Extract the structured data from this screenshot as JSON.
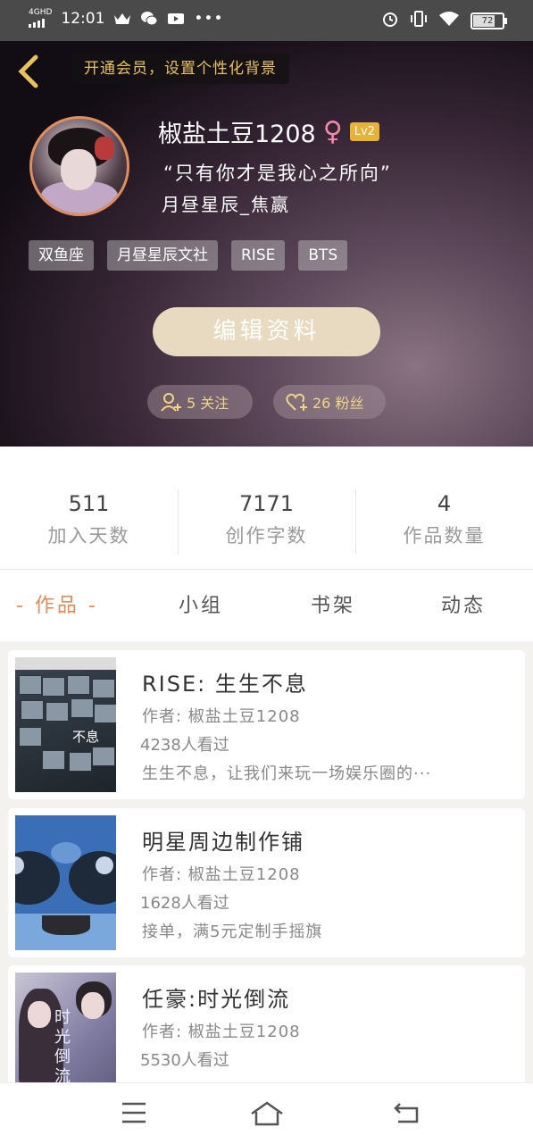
{
  "status_bar": {
    "time": "12:01",
    "network": "4GHD",
    "battery": "72"
  },
  "header": {
    "vip_prompt": "开通会员，设置个性化背景"
  },
  "profile": {
    "username": "椒盐土豆1208",
    "gender_symbol": "♀",
    "level": "Lv2",
    "quote": "“只有你才是我心之所向”",
    "subname": "月昼星辰_焦嬴",
    "tags": [
      "双鱼座",
      "月昼星辰文社",
      "RISE",
      "BTS"
    ],
    "edit_label": "编辑资料",
    "following": "5 关注",
    "followers": "26 粉丝"
  },
  "stats": [
    {
      "value": "511",
      "label": "加入天数"
    },
    {
      "value": "7171",
      "label": "创作字数"
    },
    {
      "value": "4",
      "label": "作品数量"
    }
  ],
  "tabs": [
    "- 作品 -",
    "小组",
    "书架",
    "动态"
  ],
  "works": [
    {
      "title": "RISE: 生生不息",
      "author": "作者: 椒盐土豆1208",
      "views": "4238人看过",
      "desc": "生生不息，让我们来玩一场娱乐圈的···",
      "thumb_text": "不息"
    },
    {
      "title": "明星周边制作铺",
      "author": "作者: 椒盐土豆1208",
      "views": "1628人看过",
      "desc": "接单，满5元定制手摇旗"
    },
    {
      "title": "任豪:时光倒流",
      "author": "作者: 椒盐土豆1208",
      "views": "5530人看过",
      "desc": "",
      "thumb_text": "时光倒流"
    }
  ],
  "colors": {
    "accent": "#e58a58",
    "level_badge": "#e6b23a",
    "vip_text": "#e9c25e",
    "edit_button": "#e7dac0"
  },
  "icons": [
    "back-arrow-icon",
    "menu-icon",
    "home-icon",
    "return-icon",
    "follow-user-icon",
    "heart-icon"
  ]
}
